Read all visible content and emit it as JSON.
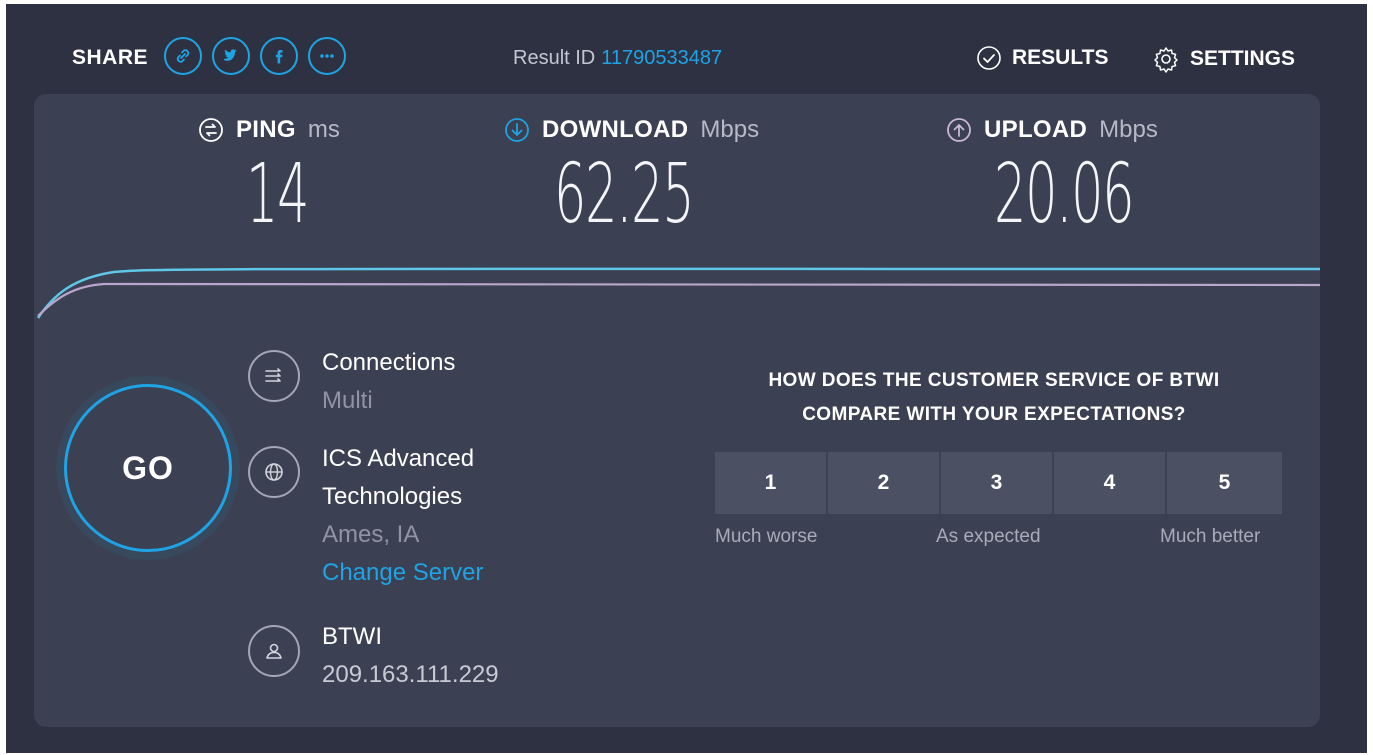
{
  "header": {
    "share_label": "SHARE",
    "share_icons": [
      "link-icon",
      "twitter-icon",
      "facebook-icon",
      "more-icon"
    ],
    "result_id_label": "Result ID",
    "result_id_value": "11790533487",
    "results_label": "RESULTS",
    "settings_label": "SETTINGS"
  },
  "metrics": {
    "ping": {
      "name": "PING",
      "unit": "ms",
      "value": "14"
    },
    "download": {
      "name": "DOWNLOAD",
      "unit": "Mbps",
      "value": "62.25"
    },
    "upload": {
      "name": "UPLOAD",
      "unit": "Mbps",
      "value": "20.06"
    }
  },
  "go_label": "GO",
  "connections": {
    "label": "Connections",
    "value": "Multi"
  },
  "server": {
    "name_line1": "ICS Advanced",
    "name_line2": "Technologies",
    "location": "Ames, IA",
    "change_label": "Change Server"
  },
  "isp": {
    "name": "BTWI",
    "ip": "209.163.111.229"
  },
  "survey": {
    "question_line1": "HOW DOES THE CUSTOMER SERVICE OF BTWI",
    "question_line2": "COMPARE WITH YOUR EXPECTATIONS?",
    "options": [
      "1",
      "2",
      "3",
      "4",
      "5"
    ],
    "label_low": "Much worse",
    "label_mid": "As expected",
    "label_high": "Much better"
  },
  "colors": {
    "accent": "#1ea4e4",
    "background": "#2e3142",
    "panel": "#3b4052",
    "download_line": "#5fc8e8",
    "upload_line": "#b9a6cc"
  }
}
